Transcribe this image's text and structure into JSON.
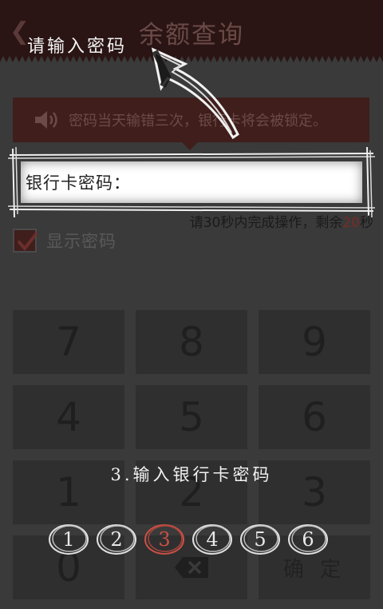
{
  "header": {
    "back_icon": "chevron-left-icon",
    "title": "余额查询"
  },
  "notice": {
    "icon": "speaker-icon",
    "text": "密码当天输错三次，银行卡将会被锁定。"
  },
  "password_field": {
    "label": "银行卡密码："
  },
  "countdown": {
    "prefix": "请30秒内完成操作，剩余",
    "seconds": "20",
    "suffix": "秒"
  },
  "show_password": {
    "label": "显示密码",
    "checked": true
  },
  "keypad": {
    "rows": [
      [
        "7",
        "8",
        "9"
      ],
      [
        "4",
        "5",
        "6"
      ],
      [
        "1",
        "2",
        "3"
      ]
    ],
    "zero": "0",
    "backspace_icon": "backspace-icon",
    "confirm": "确 定"
  },
  "overlay": {
    "hint": "请输入密码",
    "step_caption": "3.输入银行卡密码",
    "steps": [
      "1",
      "2",
      "3",
      "4",
      "5",
      "6"
    ],
    "active_step": "3",
    "colors": {
      "accent": "#c95045",
      "banner": "#3f1e1c",
      "header": "#2a1514"
    }
  }
}
